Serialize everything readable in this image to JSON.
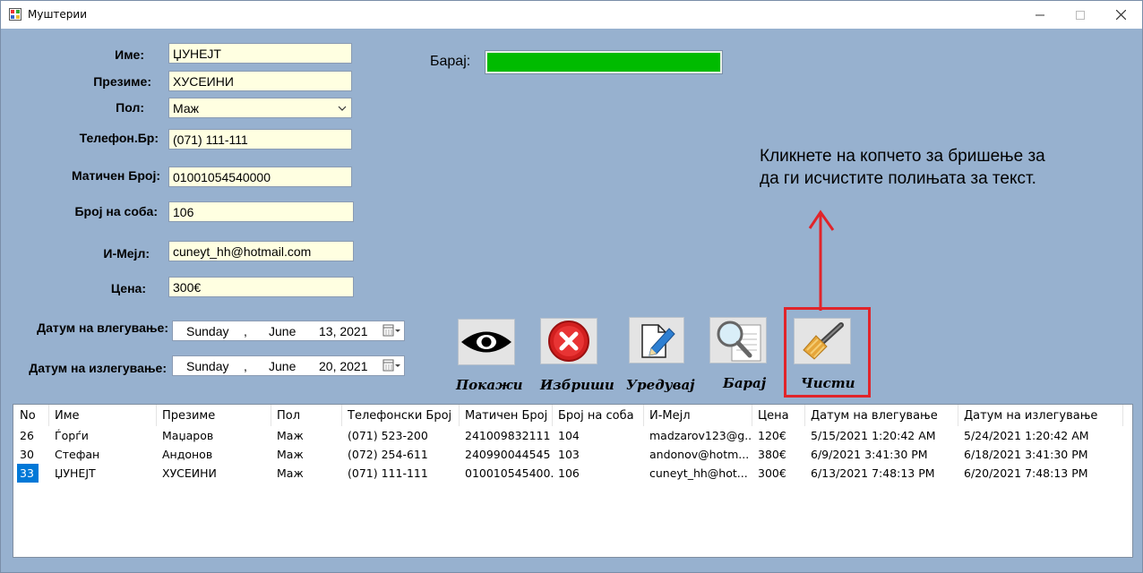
{
  "window": {
    "title": "Муштерии"
  },
  "form": {
    "first_name": {
      "label": "Име:",
      "value": "ЏУНЕЈТ"
    },
    "last_name": {
      "label": "Презиме:",
      "value": "ХУСЕИНИ"
    },
    "gender": {
      "label": "Пол:",
      "value": "Маж"
    },
    "phone": {
      "label": "Телефон.Бр:",
      "value": "(071) 111-111"
    },
    "id_number": {
      "label": "Матичен Број:",
      "value": "01001054540000"
    },
    "room": {
      "label": "Број на соба:",
      "value": "106"
    },
    "email": {
      "label": "И-Мејл:",
      "value": "cuneyt_hh@hotmail.com"
    },
    "price": {
      "label": "Цена:",
      "value": "300€"
    },
    "checkin": {
      "label": "Датум на влегување:",
      "day": "Sunday",
      "sep": ",",
      "month": "June",
      "date": "13, 2021"
    },
    "checkout": {
      "label": "Датум на излегување:",
      "day": "Sunday",
      "sep": ",",
      "month": "June",
      "date": "20, 2021"
    }
  },
  "search": {
    "label": "Барај:",
    "value": ""
  },
  "hint": {
    "line1": "Кликнете на копчето за бришење за",
    "line2": "да ги исчистите полињата за текст."
  },
  "toolbar": {
    "show_label": "Покажи",
    "delete_label": "Избриши",
    "edit_label": "Уредувај",
    "search_label": "Барај",
    "clear_label": "Чисти"
  },
  "table": {
    "columns": [
      "No",
      "Име",
      "Презиме",
      "Пол",
      "Телефонски Број",
      "Матичен Број",
      "Број на соба",
      "И-Мејл",
      "Цена",
      "Датум на влегување",
      "Датум на излегување"
    ],
    "rows": [
      [
        "26",
        "Ѓорѓи",
        "Маџаров",
        "Маж",
        "(071) 523-200",
        "241009832111",
        "104",
        "madzarov123@g...",
        "120€",
        "5/15/2021 1:20:42 AM",
        "5/24/2021 1:20:42 AM"
      ],
      [
        "30",
        "Стефан",
        "Андонов",
        "Маж",
        "(072) 254-611",
        "240990044545",
        "103",
        "andonov@hotm...",
        "380€",
        "6/9/2021 3:41:30 PM",
        "6/18/2021 3:41:30 PM"
      ],
      [
        "33",
        "ЏУНЕЈТ",
        "ХУСЕИНИ",
        "Маж",
        "(071) 111-111",
        "010010545400...",
        "106",
        "cuneyt_hh@hot...",
        "300€",
        "6/13/2021 7:48:13 PM",
        "6/20/2021 7:48:13 PM"
      ]
    ]
  },
  "colors": {
    "form_bg": "#97b1cf",
    "search_fill": "#00bb00",
    "highlight": "#e1242a",
    "selected_row": "#0078d7",
    "input_bg": "#ffffe1"
  }
}
